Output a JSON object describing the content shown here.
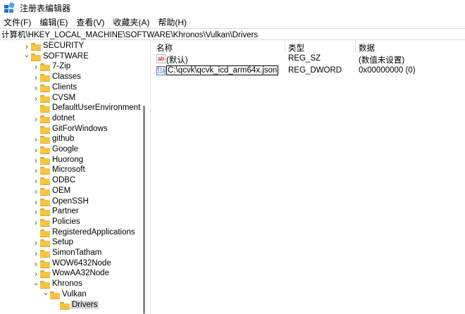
{
  "window": {
    "title": "注册表编辑器",
    "icon": "regedit-icon"
  },
  "menu": [
    {
      "label": "文件(F)"
    },
    {
      "label": "编辑(E)"
    },
    {
      "label": "查看(V)"
    },
    {
      "label": "收藏夹(A)"
    },
    {
      "label": "帮助(H)"
    }
  ],
  "address": "计算机\\HKEY_LOCAL_MACHINE\\SOFTWARE\\Khronos\\Vulkan\\Drivers",
  "tree": [
    {
      "label": "SECURITY",
      "expand": "collapsed",
      "level": 0,
      "selected": false
    },
    {
      "label": "SOFTWARE",
      "expand": "expanded",
      "level": 0,
      "selected": false
    },
    {
      "label": "7-Zip",
      "expand": "collapsed",
      "level": 1,
      "selected": false
    },
    {
      "label": "Classes",
      "expand": "collapsed",
      "level": 1,
      "selected": false
    },
    {
      "label": "Clients",
      "expand": "collapsed",
      "level": 1,
      "selected": false
    },
    {
      "label": "CVSM",
      "expand": "collapsed",
      "level": 1,
      "selected": false
    },
    {
      "label": "DefaultUserEnvironment",
      "expand": "none",
      "level": 1,
      "selected": false
    },
    {
      "label": "dotnet",
      "expand": "collapsed",
      "level": 1,
      "selected": false
    },
    {
      "label": "GitForWindows",
      "expand": "none",
      "level": 1,
      "selected": false
    },
    {
      "label": "github",
      "expand": "collapsed",
      "level": 1,
      "selected": false
    },
    {
      "label": "Google",
      "expand": "collapsed",
      "level": 1,
      "selected": false
    },
    {
      "label": "Huorong",
      "expand": "collapsed",
      "level": 1,
      "selected": false
    },
    {
      "label": "Microsoft",
      "expand": "collapsed",
      "level": 1,
      "selected": false
    },
    {
      "label": "ODBC",
      "expand": "collapsed",
      "level": 1,
      "selected": false
    },
    {
      "label": "OEM",
      "expand": "collapsed",
      "level": 1,
      "selected": false
    },
    {
      "label": "OpenSSH",
      "expand": "collapsed",
      "level": 1,
      "selected": false
    },
    {
      "label": "Partner",
      "expand": "collapsed",
      "level": 1,
      "selected": false
    },
    {
      "label": "Policies",
      "expand": "collapsed",
      "level": 1,
      "selected": false
    },
    {
      "label": "RegisteredApplications",
      "expand": "none",
      "level": 1,
      "selected": false
    },
    {
      "label": "Setup",
      "expand": "collapsed",
      "level": 1,
      "selected": false
    },
    {
      "label": "SimonTatham",
      "expand": "collapsed",
      "level": 1,
      "selected": false
    },
    {
      "label": "WOW6432Node",
      "expand": "collapsed",
      "level": 1,
      "selected": false
    },
    {
      "label": "WowAA32Node",
      "expand": "collapsed",
      "level": 1,
      "selected": false
    },
    {
      "label": "Khronos",
      "expand": "expanded",
      "level": 1,
      "selected": false
    },
    {
      "label": "Vulkan",
      "expand": "expanded",
      "level": 2,
      "selected": false
    },
    {
      "label": "Drivers",
      "expand": "none",
      "level": 3,
      "selected": true
    }
  ],
  "columns": {
    "name": "名称",
    "type": "类型",
    "data": "数据"
  },
  "values": [
    {
      "icon": "string-value-icon",
      "name": "(默认)",
      "type": "REG_SZ",
      "data": "(数值未设置)",
      "editing": false
    },
    {
      "icon": "binary-value-icon",
      "name": "C:\\qcvk\\qcvk_icd_arm64x.json",
      "type": "REG_DWORD",
      "data": "0x00000000 (0)",
      "editing": true
    }
  ]
}
